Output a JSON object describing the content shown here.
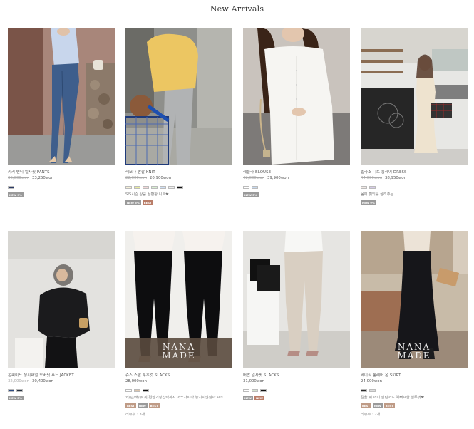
{
  "header": {
    "title": "New Arrivals"
  },
  "products": [
    {
      "name": "키키 빈티 일자핏 PANTS",
      "old_price": "36,000won",
      "price": "33,250won",
      "swatches": [
        "#2b3a66"
      ],
      "badges": [
        "NEW 9%"
      ],
      "desc": "",
      "review": ""
    },
    {
      "name": "레모나 반팔 KNIT",
      "old_price": "22,000won",
      "price": "20,900won",
      "swatches": [
        "#f6f0d8",
        "#e8ec9f",
        "#f3d7d8",
        "#d8efd1",
        "#cfe0f5",
        "#f0f0f0",
        "#111111"
      ],
      "badges": [
        "NEW 5%",
        "BEST"
      ],
      "desc": "S/S시즌 상큼 끝판왕 니트❤",
      "review": ""
    },
    {
      "name": "레블라 BLOUSE",
      "old_price": "42,000won",
      "price": "39,900won",
      "swatches": [
        "#ffffff",
        "#c7d9ee"
      ],
      "badges": [
        "NEW 5%"
      ],
      "desc": "",
      "review": ""
    },
    {
      "name": "빌라조 니트 롱레어 DRESS",
      "old_price": "44,000won",
      "price": "38,950won",
      "swatches": [
        "#f1e9e4",
        "#d6cbe8"
      ],
      "badges": [
        "NEW 9%"
      ],
      "desc": "몸에 핏되를 살려주는..",
      "review": ""
    },
    {
      "name": "논퍼이드 생지패널 오버핏 후드 JACKET",
      "old_price": "32,000won",
      "price": "30,400won",
      "swatches": [
        "#2b4a82",
        "#24303f"
      ],
      "badges": [
        "NEW 5%"
      ],
      "desc": "",
      "review": ""
    },
    {
      "name": "쥬즈 스판 부츠컷 SLACKS",
      "old_price": "",
      "price": "28,000won",
      "swatches": [
        "#ffffff",
        "#dcc5ad",
        "#111111"
      ],
      "badges": [
        "BEST",
        "NEW",
        "BEST"
      ],
      "desc": "키/단/배/주 핏,편한기장선택까지 어느차피나 놓치지않않아 요~",
      "review": "리뷰수 : 3개"
    },
    {
      "name": "어반 일자핏 SLACKS",
      "old_price": "",
      "price": "31,000won",
      "swatches": [
        "#ffffff",
        "#d6e3cf",
        "#111111"
      ],
      "badges": [
        "NEW",
        "NEW"
      ],
      "desc": "",
      "review": ""
    },
    {
      "name": "베이직 롱레어 온 SKIRT",
      "old_price": "",
      "price": "24,000won",
      "swatches": [
        "#2a2a2a",
        "#dddddd"
      ],
      "badges": [
        "BEST",
        "NEW",
        "BEST"
      ],
      "desc": "길을 뭐 어디 잘린어도 예뻐요한 실루엣❤",
      "review": "리뷰수 : 2개"
    }
  ],
  "overlays": {
    "brand_line1": "NANA",
    "brand_line2": "MADE"
  }
}
